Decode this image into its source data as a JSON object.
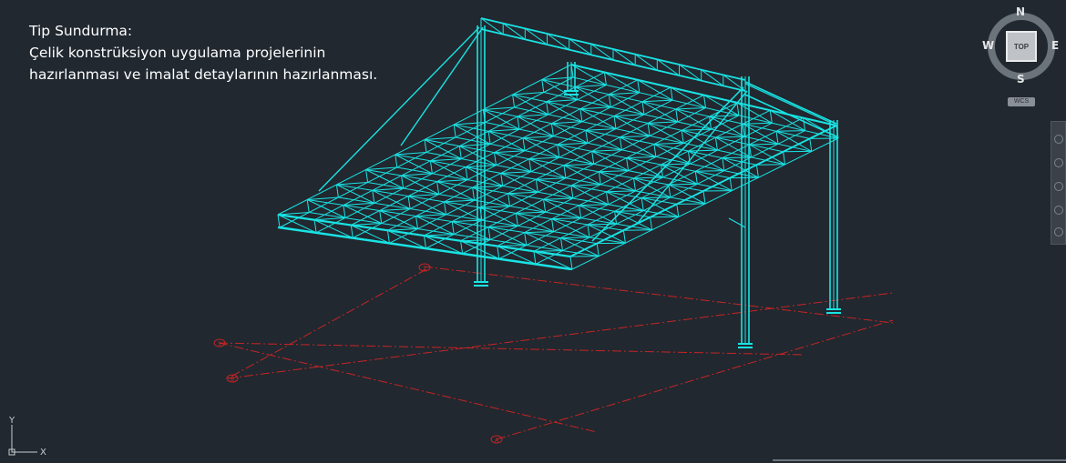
{
  "caption": {
    "title": "Tip Sundurma:",
    "line1": "Çelik konstrüksiyon uygulama projelerinin",
    "line2": "hazırlanması ve imalat detaylarının hazırlanması."
  },
  "viewcube": {
    "north": "N",
    "south": "S",
    "east": "E",
    "west": "W",
    "face": "TOP"
  },
  "wcs": {
    "label": "WCS"
  },
  "ucs": {
    "x_label": "X",
    "y_label": "Y"
  },
  "grid_bubbles": [
    "1",
    "2",
    "B",
    "A"
  ],
  "colors": {
    "background": "#212830",
    "structure": "#19e3e3",
    "grid_lines": "#cc1f1f",
    "text": "#ffffff"
  },
  "icons": {
    "viewcube": "viewcube-compass-icon",
    "navigation": "navigation-bar-icon",
    "ucs": "ucs-axis-icon"
  }
}
